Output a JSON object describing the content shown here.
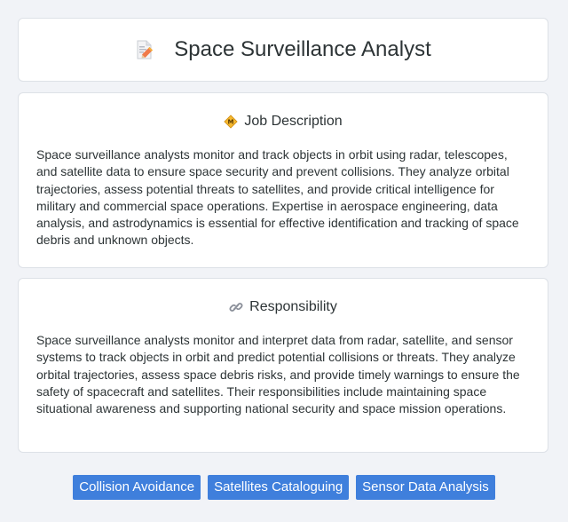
{
  "header": {
    "title": "Space Surveillance Analyst",
    "icon": "document-pencil-icon"
  },
  "job_description": {
    "heading": "Job Description",
    "icon": "diamond-sign-icon",
    "text": "Space surveillance analysts monitor and track objects in orbit using radar, telescopes, and satellite data to ensure space security and prevent collisions. They analyze orbital trajectories, assess potential threats to satellites, and provide critical intelligence for military and commercial space operations. Expertise in aerospace engineering, data analysis, and astrodynamics is essential for effective identification and tracking of space debris and unknown objects."
  },
  "responsibility": {
    "heading": "Responsibility",
    "icon": "link-icon",
    "text": "Space surveillance analysts monitor and interpret data from radar, satellite, and sensor systems to track objects in orbit and predict potential collisions or threats. They analyze orbital trajectories, assess space debris risks, and provide timely warnings to ensure the safety of spacecraft and satellites. Their responsibilities include maintaining space situational awareness and supporting national security and space mission operations."
  },
  "tags": [
    "Collision Avoidance",
    "Satellites Cataloguing",
    "Sensor Data Analysis"
  ],
  "colors": {
    "background": "#f1f3f7",
    "card": "#ffffff",
    "tag": "#3f7fdc",
    "text": "#2d3436"
  }
}
